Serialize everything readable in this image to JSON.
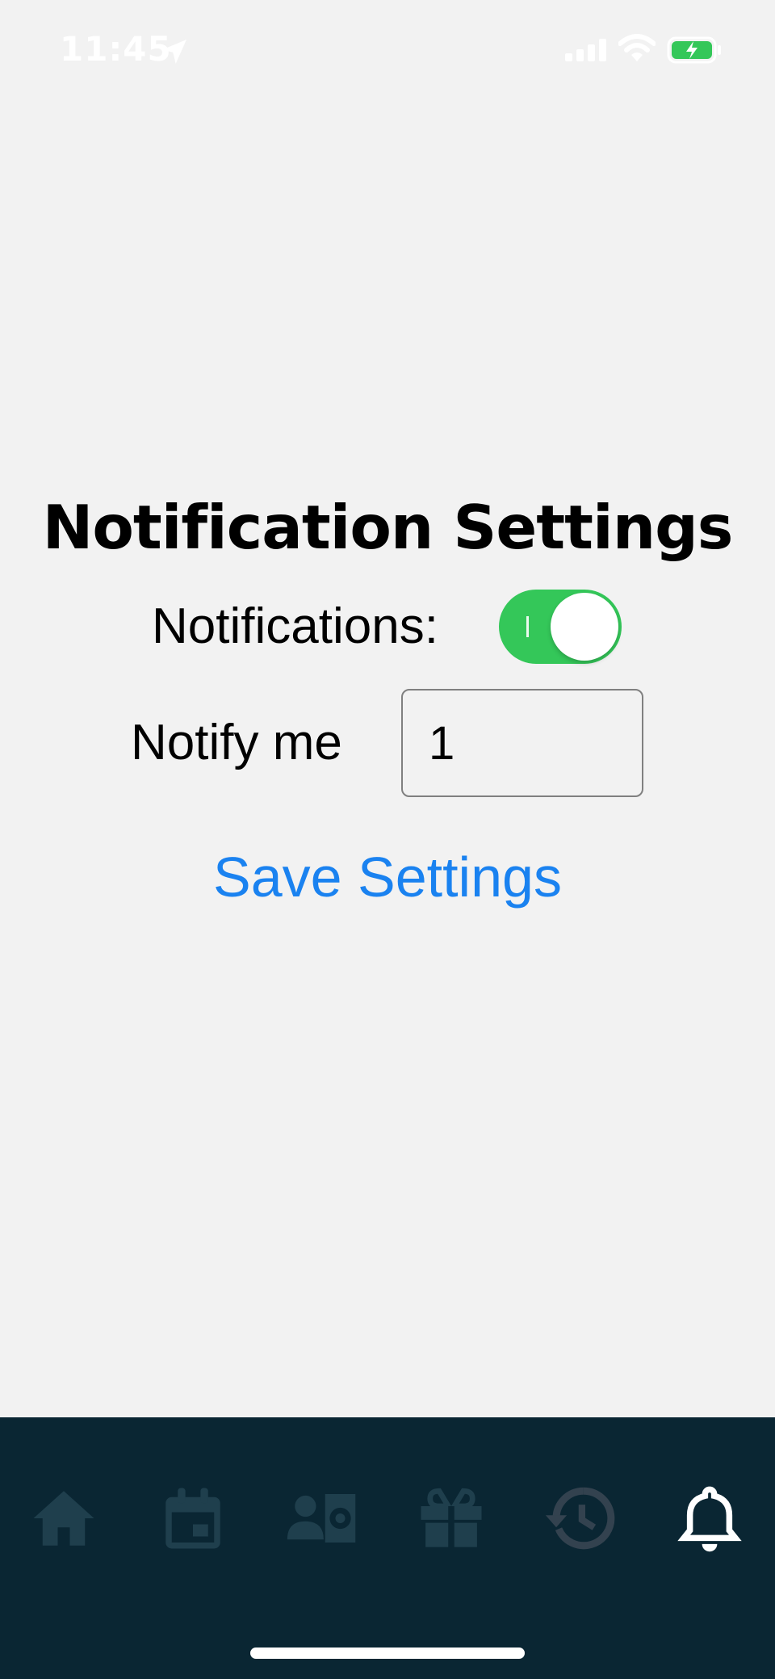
{
  "status_bar": {
    "time": "11:45",
    "icons": [
      "location-arrow-icon",
      "cellular-signal-icon",
      "wifi-icon",
      "battery-charging-icon"
    ]
  },
  "main": {
    "title": "Notification Settings",
    "notifications_label": "Notifications:",
    "notifications_enabled": true,
    "notify_label": "Notify me",
    "notify_value": "1",
    "save_label": "Save Settings"
  },
  "tab_bar": {
    "tabs": [
      {
        "icon": "home-icon",
        "active": false
      },
      {
        "icon": "calendar-icon",
        "active": false
      },
      {
        "icon": "contact-money-icon",
        "active": false
      },
      {
        "icon": "gift-icon",
        "active": false
      },
      {
        "icon": "history-icon",
        "active": false
      },
      {
        "icon": "bell-icon",
        "active": true
      }
    ]
  },
  "colors": {
    "background": "#f2f2f2",
    "tab_bar": "#0a2633",
    "tab_inactive": "#1f3f4d",
    "tab_active": "#ffffff",
    "toggle_on": "#34c759",
    "link": "#1a82f0"
  }
}
